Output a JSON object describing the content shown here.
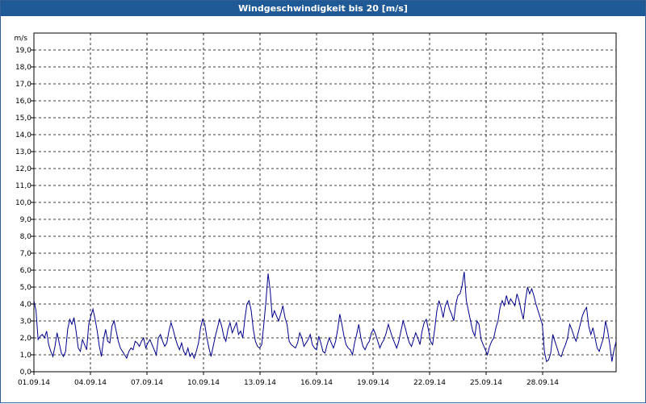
{
  "window": {
    "title": "Windgeschwindigkeit bis 20 [m/s]"
  },
  "chart_data": {
    "type": "line",
    "title": "Windgeschwindigkeit bis 20 [m/s]",
    "ylabel": "m/s",
    "xlabel": "",
    "ylim": [
      0,
      20
    ],
    "xlim_days": [
      0,
      30.9
    ],
    "grid": true,
    "line_color": "#00008b",
    "x_ticks": [
      "01.09.14",
      "04.09.14",
      "07.09.14",
      "10.09.14",
      "13.09.14",
      "16.09.14",
      "19.09.14",
      "22.09.14",
      "25.09.14",
      "28.09.14"
    ],
    "y_ticks": [
      "0,0",
      "1,0",
      "2,0",
      "3,0",
      "4,0",
      "5,0",
      "6,0",
      "7,0",
      "8,0",
      "9,0",
      "10,0",
      "11,0",
      "12,0",
      "13,0",
      "14,0",
      "15,0",
      "16,0",
      "17,0",
      "18,0",
      "19,0"
    ],
    "series": [
      {
        "values": [
          4.2,
          3.6,
          1.9,
          2.1,
          2.2,
          2.0,
          2.4,
          1.6,
          1.2,
          0.9,
          1.5,
          2.3,
          1.7,
          1.1,
          0.9,
          1.2,
          2.5,
          3.1,
          2.8,
          3.2,
          2.4,
          1.4,
          1.2,
          1.9,
          1.6,
          1.3,
          2.8,
          3.3,
          3.7,
          3.1,
          2.4,
          1.5,
          0.9,
          1.9,
          2.5,
          1.8,
          1.7,
          2.7,
          3.0,
          2.4,
          1.8,
          1.4,
          1.2,
          1.0,
          0.8,
          1.2,
          1.4,
          1.3,
          1.8,
          1.7,
          1.5,
          1.8,
          2.0,
          1.4,
          1.7,
          1.9,
          1.6,
          1.3,
          1.0,
          2.0,
          2.2,
          1.8,
          1.5,
          1.7,
          2.4,
          2.9,
          2.5,
          2.0,
          1.6,
          1.3,
          1.7,
          1.2,
          1.0,
          1.4,
          0.9,
          1.1,
          0.8,
          1.2,
          1.7,
          2.6,
          3.1,
          2.8,
          2.0,
          1.4,
          0.9,
          1.5,
          2.1,
          2.6,
          3.1,
          2.7,
          2.1,
          1.8,
          2.5,
          2.9,
          2.3,
          2.6,
          2.9,
          2.2,
          2.4,
          2.0,
          3.1,
          4.0,
          4.2,
          3.6,
          2.5,
          1.8,
          1.5,
          1.4,
          1.6,
          2.8,
          4.2,
          5.8,
          4.8,
          3.2,
          3.6,
          3.3,
          3.0,
          3.4,
          3.9,
          3.2,
          2.8,
          1.8,
          1.6,
          1.5,
          1.4,
          1.7,
          2.3,
          2.0,
          1.5,
          1.7,
          1.9,
          2.2,
          1.6,
          1.4,
          1.3,
          2.1,
          1.7,
          1.2,
          1.1,
          1.6,
          2.0,
          1.7,
          1.4,
          1.8,
          2.5,
          3.4,
          2.8,
          2.1,
          1.6,
          1.4,
          1.3,
          1.0,
          1.7,
          2.2,
          2.8,
          2.0,
          1.5,
          1.3,
          1.6,
          1.8,
          2.3,
          2.5,
          2.2,
          1.8,
          1.4,
          1.7,
          1.9,
          2.3,
          2.8,
          2.4,
          2.0,
          1.7,
          1.4,
          1.8,
          2.4,
          3.0,
          2.6,
          2.1,
          1.7,
          1.5,
          1.9,
          2.3,
          2.0,
          1.6,
          2.4,
          2.9,
          3.1,
          2.5,
          1.8,
          1.6,
          2.5,
          3.6,
          4.2,
          3.8,
          3.2,
          3.9,
          4.2,
          3.7,
          3.4,
          3.0,
          4.0,
          4.5,
          4.6,
          5.1,
          5.9,
          4.2,
          3.6,
          3.0,
          2.4,
          2.1,
          3.0,
          2.8,
          1.9,
          1.6,
          1.3,
          1.0,
          1.5,
          1.8,
          2.0,
          2.6,
          3.0,
          3.8,
          4.2,
          3.9,
          4.5,
          4.0,
          4.3,
          4.1,
          3.9,
          4.6,
          4.2,
          3.6,
          3.1,
          4.2,
          5.0,
          4.6,
          4.9,
          4.5,
          4.0,
          3.6,
          3.2,
          2.8,
          1.2,
          0.6,
          0.7,
          1.1,
          2.2,
          1.8,
          1.4,
          1.0,
          0.9,
          1.3,
          1.6,
          2.0,
          2.8,
          2.5,
          2.1,
          1.8,
          2.3,
          2.8,
          3.3,
          3.6,
          3.8,
          2.7,
          2.2,
          2.6,
          2.0,
          1.4,
          1.2,
          1.6,
          2.0,
          3.0,
          2.4,
          1.6,
          0.6,
          1.3,
          1.8
        ]
      }
    ]
  }
}
